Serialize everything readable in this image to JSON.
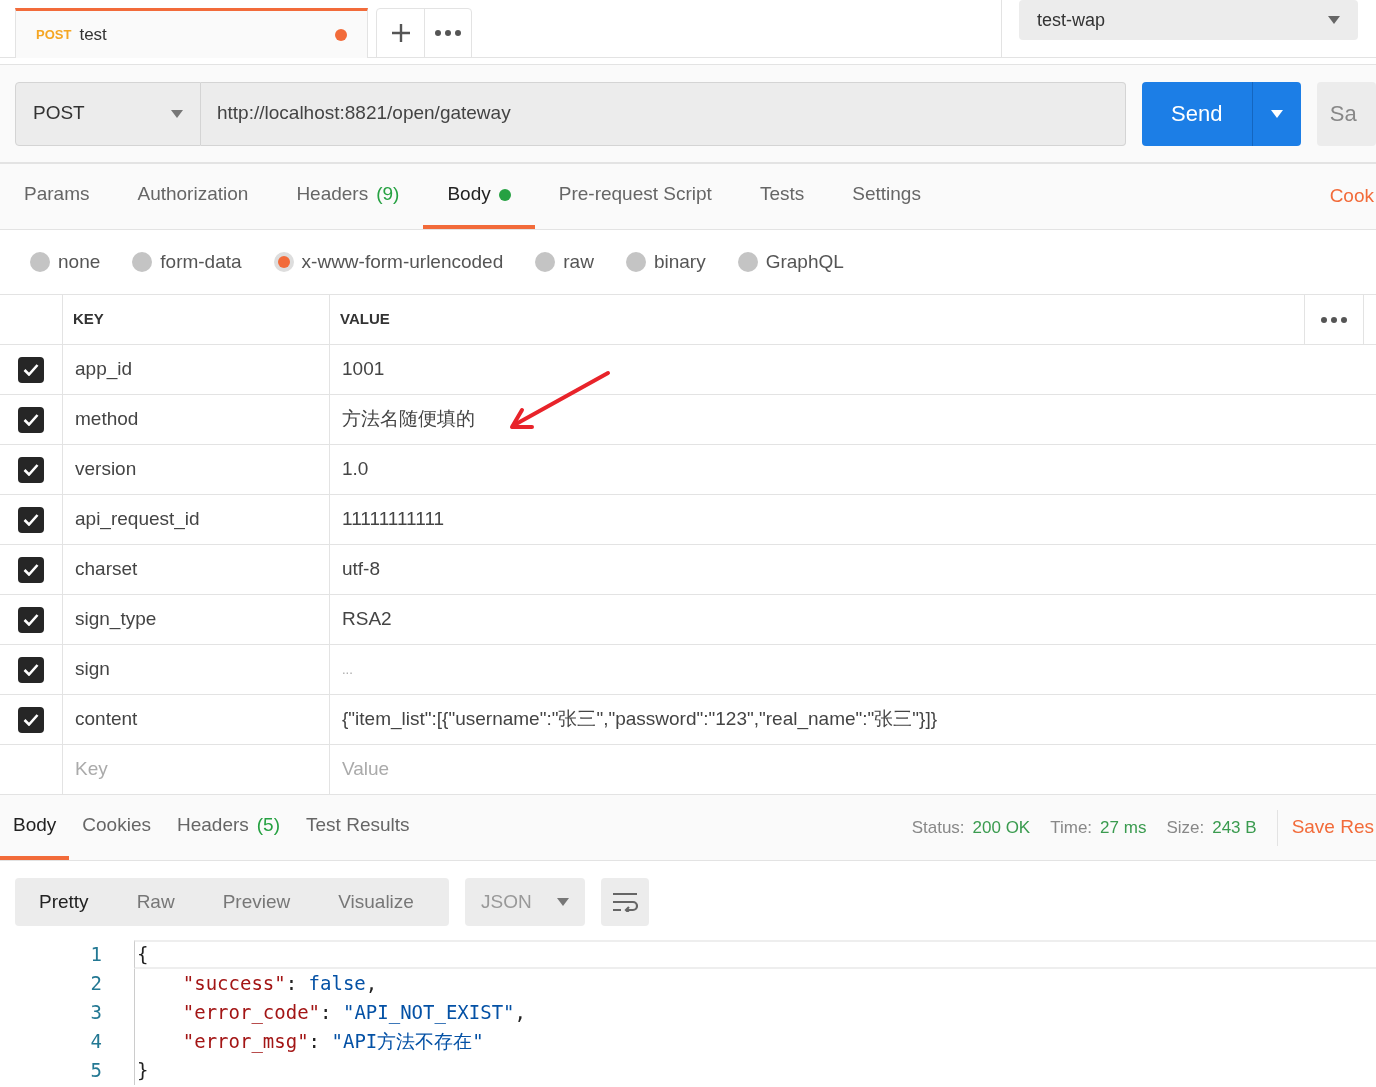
{
  "request_tab": {
    "method": "POST",
    "name": "test",
    "unsaved": true
  },
  "environment": {
    "value": "test-wap"
  },
  "request": {
    "method": "POST",
    "url": "http://localhost:8821/open/gateway",
    "send": "Send",
    "save": "Sa"
  },
  "tabs": [
    {
      "label": "Params",
      "selected": false
    },
    {
      "label": "Authorization",
      "selected": false
    },
    {
      "label": "Headers",
      "count": "(9)",
      "selected": false
    },
    {
      "label": "Body",
      "dot": true,
      "selected": true
    },
    {
      "label": "Pre-request Script",
      "selected": false
    },
    {
      "label": "Tests",
      "selected": false
    },
    {
      "label": "Settings",
      "selected": false
    }
  ],
  "cookies_link": "Cook",
  "body_types": [
    {
      "label": "none",
      "selected": false
    },
    {
      "label": "form-data",
      "selected": false
    },
    {
      "label": "x-www-form-urlencoded",
      "selected": true
    },
    {
      "label": "raw",
      "selected": false
    },
    {
      "label": "binary",
      "selected": false
    },
    {
      "label": "GraphQL",
      "selected": false
    }
  ],
  "table": {
    "columns": [
      "KEY",
      "VALUE"
    ],
    "rows": [
      {
        "key": "app_id",
        "value": "1001",
        "checked": true
      },
      {
        "key": "method",
        "value": "方法名随便填的",
        "checked": true
      },
      {
        "key": "version",
        "value": "1.0",
        "checked": true
      },
      {
        "key": "api_request_id",
        "value": "11111111111",
        "checked": true
      },
      {
        "key": "charset",
        "value": "utf-8",
        "checked": true
      },
      {
        "key": "sign_type",
        "value": "RSA2",
        "checked": true
      },
      {
        "key": "sign",
        "value": "...",
        "checked": true
      },
      {
        "key": "content",
        "value": "{\"item_list\":[{\"username\":\"张三\",\"password\":\"123\",\"real_name\":\"张三\"}]}",
        "checked": true
      }
    ],
    "new_row": {
      "key_placeholder": "Key",
      "value_placeholder": "Value"
    }
  },
  "response": {
    "tabs": [
      {
        "label": "Body",
        "selected": true
      },
      {
        "label": "Cookies",
        "selected": false
      },
      {
        "label": "Headers",
        "count": "(5)",
        "selected": false
      },
      {
        "label": "Test Results",
        "selected": false
      }
    ],
    "stats": [
      {
        "label": "Status:",
        "value": "200 OK"
      },
      {
        "label": "Time:",
        "value": "27 ms"
      },
      {
        "label": "Size:",
        "value": "243 B"
      }
    ],
    "save": "Save Res",
    "view_modes": [
      {
        "label": "Pretty",
        "selected": true
      },
      {
        "label": "Raw",
        "selected": false
      },
      {
        "label": "Preview",
        "selected": false
      },
      {
        "label": "Visualize",
        "selected": false
      }
    ],
    "format": "JSON",
    "code": [
      {
        "number": "1",
        "tokens": [
          {
            "kind": "punct",
            "text": "{"
          }
        ]
      },
      {
        "number": "2",
        "tokens": [
          {
            "kind": "key",
            "text": "\"success\""
          },
          {
            "kind": "punct",
            "text": ": "
          },
          {
            "kind": "bool",
            "text": "false"
          },
          {
            "kind": "punct",
            "text": ","
          }
        ]
      },
      {
        "number": "3",
        "tokens": [
          {
            "kind": "key",
            "text": "\"error_code\""
          },
          {
            "kind": "punct",
            "text": ": "
          },
          {
            "kind": "string",
            "text": "\"API_NOT_EXIST\""
          },
          {
            "kind": "punct",
            "text": ","
          }
        ]
      },
      {
        "number": "4",
        "tokens": [
          {
            "kind": "key",
            "text": "\"error_msg\""
          },
          {
            "kind": "punct",
            "text": ": "
          },
          {
            "kind": "string",
            "text": "\"API方法不存在\""
          }
        ]
      },
      {
        "number": "5",
        "tokens": [
          {
            "kind": "punct",
            "text": "}"
          }
        ]
      }
    ]
  }
}
